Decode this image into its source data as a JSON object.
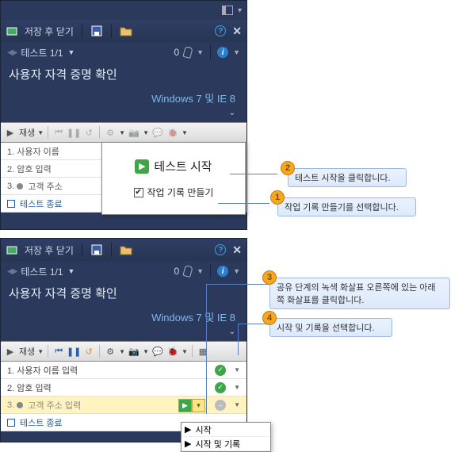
{
  "titlebar": {
    "title": "저장 후 닫기"
  },
  "subbar": {
    "test_label": "테스트 1/1",
    "count": "0"
  },
  "heading": "사용자 자격 증명 확인",
  "environment": "Windows 7 및 IE 8",
  "toolbar": {
    "play_label": "재생"
  },
  "panel1": {
    "steps": {
      "s1": "1. 사용자 이름",
      "s2": "2. 암호 입력",
      "s3": "3.",
      "s3b": "고객 주소",
      "s4": "테스트 종료"
    },
    "popup": {
      "start": "테스트 시작",
      "checkbox": "작업 기록 만들기"
    }
  },
  "panel2": {
    "steps": {
      "s1": "1. 사용자 이름 입력",
      "s2": "2. 암호 입력",
      "s3": "3.",
      "s3b": "고객 주소 입력",
      "s4": "테스트 종료"
    },
    "dropdown": {
      "item1": "시작",
      "item2": "시작 및 기록"
    }
  },
  "callouts": {
    "c1": {
      "num": "1",
      "text": "작업 기록 만들기를 선택합니다."
    },
    "c2": {
      "num": "2",
      "text": "테스트 시작을 클릭합니다."
    },
    "c3": {
      "num": "3",
      "text": "공유 단계의 녹색 화살표 오른쪽에 있는 아래쪽 화살표를 클릭합니다."
    },
    "c4": {
      "num": "4",
      "text": "시작 및 기록을 선택합니다."
    }
  }
}
